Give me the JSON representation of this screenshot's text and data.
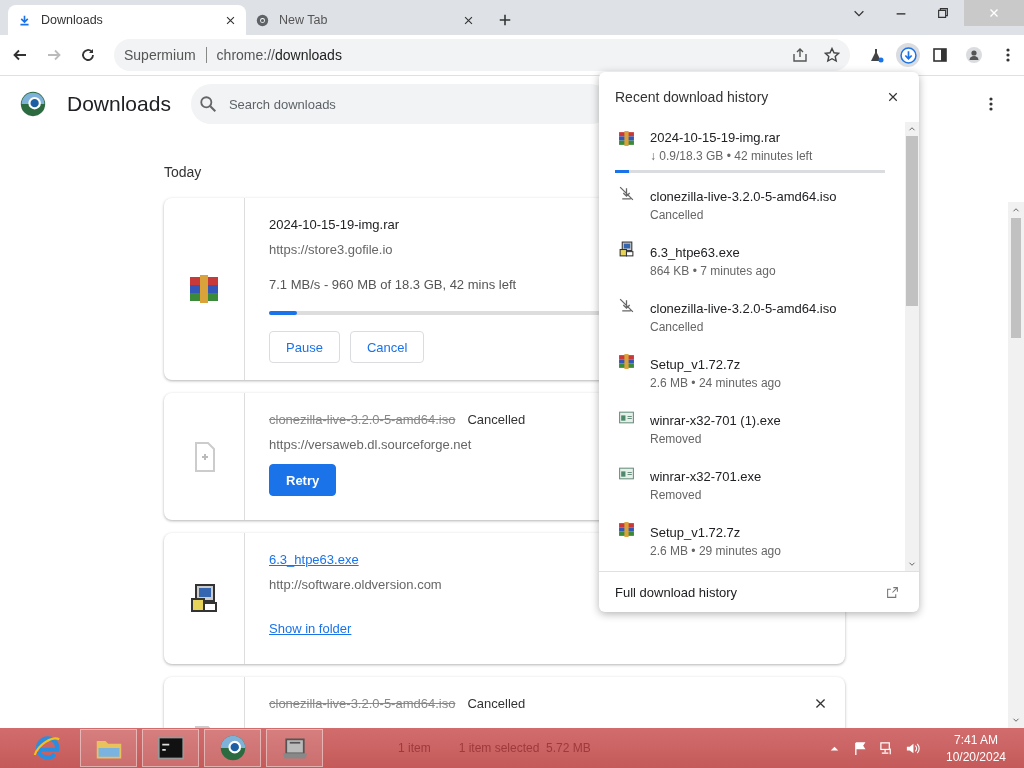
{
  "tabs": [
    {
      "label": "Downloads",
      "selected": true,
      "kind": "downloads"
    },
    {
      "label": "New Tab",
      "selected": false,
      "kind": "new_tab"
    }
  ],
  "address_bar": {
    "site_label": "Supermium",
    "url_scheme": "chrome://",
    "url_path": "downloads"
  },
  "page": {
    "title": "Downloads",
    "search": {
      "placeholder": "Search downloads"
    },
    "date_heading": "Today",
    "downloads": [
      {
        "kind": "active",
        "file": {
          "kind": "archive"
        },
        "name": "2024-10-15-19-img.rar",
        "url": "https://store3.gofile.io",
        "status_text": "7.1 MB/s - 960 MB of 18.3 GB, 42 mins left",
        "level": 0.05,
        "buttons": [
          "Pause",
          "Cancel"
        ]
      },
      {
        "kind": "cancelled",
        "file": {
          "kind": "blank"
        },
        "name": "clonezilla-live-3.2.0-5-amd64.iso",
        "state_label": "Cancelled",
        "url": "https://versaweb.dl.sourceforge.net",
        "buttons": [
          "Retry"
        ]
      },
      {
        "kind": "complete",
        "file": {
          "kind": "installer"
        },
        "name": "6.3_htpe63.exe",
        "url": "http://software.oldversion.com",
        "link": "Show in folder"
      },
      {
        "kind": "cancelled",
        "file": {
          "kind": "blank"
        },
        "name": "clonezilla-live-3.2.0-5-amd64.iso",
        "state_label": "Cancelled",
        "removable": true
      }
    ]
  },
  "popup": {
    "title": "Recent download history",
    "footer": "Full download history",
    "items": [
      {
        "kind": "archive",
        "name": "2024-10-15-19-img.rar",
        "detail": "↓ 0.9/18.3 GB • 42 minutes left",
        "level": 0.05
      },
      {
        "kind": "cancelled",
        "name": "clonezilla-live-3.2.0-5-amd64.iso",
        "detail": "Cancelled"
      },
      {
        "kind": "installer",
        "name": "6.3_htpe63.exe",
        "detail": "864 KB • 7 minutes ago"
      },
      {
        "kind": "cancelled",
        "name": "clonezilla-live-3.2.0-5-amd64.iso",
        "detail": "Cancelled"
      },
      {
        "kind": "archive",
        "name": "Setup_v1.72.7z",
        "detail": "2.6 MB • 24 minutes ago"
      },
      {
        "kind": "program",
        "name": "winrar-x32-701 (1).exe",
        "detail": "Removed"
      },
      {
        "kind": "program",
        "name": "winrar-x32-701.exe",
        "detail": "Removed"
      },
      {
        "kind": "archive",
        "name": "Setup_v1.72.7z",
        "detail": "2.6 MB • 29 minutes ago"
      }
    ]
  },
  "taskbar": {
    "apps": [
      {
        "kind": "ie",
        "selected": false
      },
      {
        "kind": "folder",
        "selected": true
      },
      {
        "kind": "console",
        "selected": true
      },
      {
        "kind": "browser",
        "selected": true
      },
      {
        "kind": "drive",
        "selected": true
      }
    ],
    "background_text": [
      "1 item",
      "1 item selected  5.72 MB"
    ],
    "time": "7:41 AM",
    "date": "10/20/2024"
  }
}
